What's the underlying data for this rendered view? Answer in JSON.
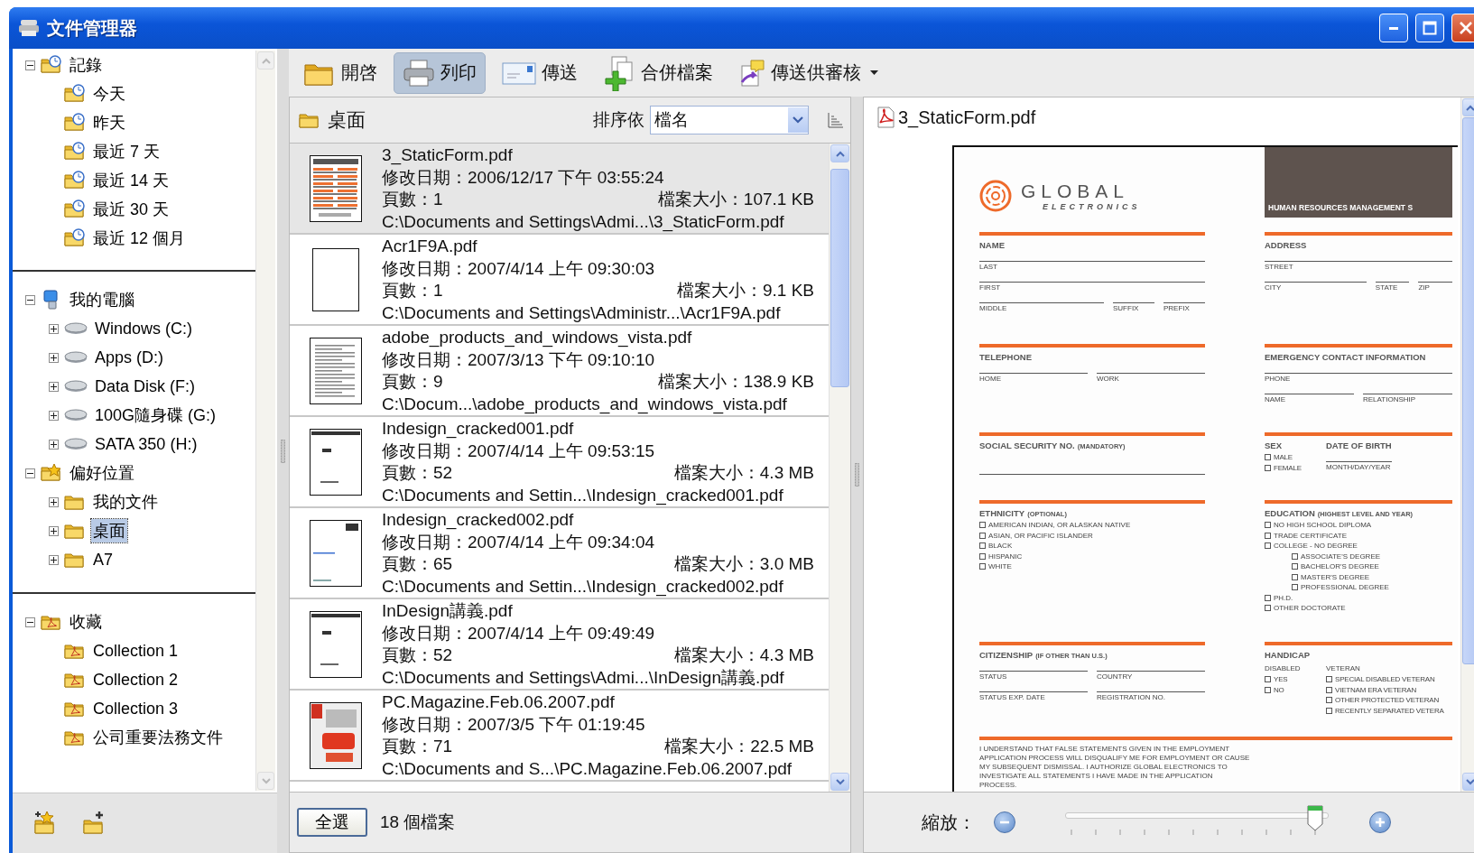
{
  "window": {
    "title": "文件管理器"
  },
  "sidebar": {
    "sections": [
      {
        "items": [
          {
            "label": "記錄",
            "kind": "history",
            "expanded": true,
            "selected": false,
            "children": [
              {
                "label": "今天",
                "kind": "clock",
                "selected": false
              },
              {
                "label": "昨天",
                "kind": "clock",
                "selected": false
              },
              {
                "label": "最近 7 天",
                "kind": "clock",
                "selected": false
              },
              {
                "label": "最近 14 天",
                "kind": "clock",
                "selected": false
              },
              {
                "label": "最近 30 天",
                "kind": "clock",
                "selected": false
              },
              {
                "label": "最近 12 個月",
                "kind": "clock",
                "selected": false
              }
            ]
          }
        ]
      },
      {
        "items": [
          {
            "label": "我的電腦",
            "kind": "computer",
            "expanded": true,
            "selected": false,
            "children": [
              {
                "label": "Windows (C:)",
                "kind": "drive",
                "expanded": false,
                "selected": false
              },
              {
                "label": "Apps (D:)",
                "kind": "drive",
                "expanded": false,
                "selected": false
              },
              {
                "label": "Data Disk (F:)",
                "kind": "drive",
                "expanded": false,
                "selected": false
              },
              {
                "label": "100G隨身碟 (G:)",
                "kind": "drive",
                "expanded": false,
                "selected": false
              },
              {
                "label": "SATA 350 (H:)",
                "kind": "drive",
                "expanded": false,
                "selected": false
              }
            ]
          },
          {
            "label": "偏好位置",
            "kind": "favorites",
            "expanded": true,
            "selected": false,
            "children": [
              {
                "label": "我的文件",
                "kind": "folder",
                "expanded": false,
                "selected": false
              },
              {
                "label": "桌面",
                "kind": "folder",
                "expanded": false,
                "selected": true
              },
              {
                "label": "A7",
                "kind": "folder",
                "expanded": false,
                "selected": false
              }
            ]
          }
        ]
      },
      {
        "items": [
          {
            "label": "收藏",
            "kind": "collection",
            "expanded": true,
            "selected": false,
            "children": [
              {
                "label": "Collection 1",
                "kind": "collection",
                "selected": false
              },
              {
                "label": "Collection 2",
                "kind": "collection",
                "selected": false
              },
              {
                "label": "Collection 3",
                "kind": "collection",
                "selected": false
              },
              {
                "label": "公司重要法務文件",
                "kind": "collection",
                "selected": false
              }
            ]
          }
        ]
      }
    ]
  },
  "toolbar": {
    "items": [
      {
        "label": "開啓",
        "kind": "open",
        "active": false,
        "menu": false
      },
      {
        "label": "列印",
        "kind": "print",
        "active": true,
        "menu": false
      },
      {
        "label": "傳送",
        "kind": "send",
        "active": false,
        "menu": false
      },
      {
        "label": "合併檔案",
        "kind": "merge",
        "active": false,
        "menu": false
      },
      {
        "label": "傳送供審核",
        "kind": "review",
        "active": false,
        "menu": true
      }
    ]
  },
  "file_list": {
    "location": "桌面",
    "sort_label": "排序依",
    "sort_value": "檔名",
    "files": [
      {
        "name": "3_StaticForm.pdf",
        "modified": "修改日期：2006/12/17 下午 03:55:24",
        "pages": "頁數：1",
        "size": "檔案大小：107.1 KB",
        "path": "C:\\Documents and Settings\\Admi...\\3_StaticForm.pdf",
        "kind": "form",
        "selected": true
      },
      {
        "name": "Acr1F9A.pdf",
        "modified": "修改日期：2007/4/14 上午 09:30:03",
        "pages": "頁數：1",
        "size": "檔案大小：9.1 KB",
        "path": "C:\\Documents and Settings\\Administr...\\Acr1F9A.pdf",
        "kind": "blank",
        "selected": false
      },
      {
        "name": "adobe_products_and_windows_vista.pdf",
        "modified": "修改日期：2007/3/13 下午 09:10:10",
        "pages": "頁數：9",
        "size": "檔案大小：138.9 KB",
        "path": "C:\\Docum...\\adobe_products_and_windows_vista.pdf",
        "kind": "text",
        "selected": false
      },
      {
        "name": "Indesign_cracked001.pdf",
        "modified": "修改日期：2007/4/14 上午 09:53:15",
        "pages": "頁數：52",
        "size": "檔案大小：4.3 MB",
        "path": "C:\\Documents and Settin...\\Indesign_cracked001.pdf",
        "kind": "layout",
        "selected": false
      },
      {
        "name": "Indesign_cracked002.pdf",
        "modified": "修改日期：2007/4/14 上午 09:34:04",
        "pages": "頁數：65",
        "size": "檔案大小：3.0 MB",
        "path": "C:\\Documents and Settin...\\Indesign_cracked002.pdf",
        "kind": "sparse",
        "selected": false
      },
      {
        "name": "InDesign講義.pdf",
        "modified": "修改日期：2007/4/14 上午 09:49:49",
        "pages": "頁數：52",
        "size": "檔案大小：4.3 MB",
        "path": "C:\\Documents and Settings\\Admi...\\InDesign講義.pdf",
        "kind": "layout",
        "selected": false
      },
      {
        "name": "PC.Magazine.Feb.06.2007.pdf",
        "modified": "修改日期：2007/3/5 下午 01:19:45",
        "pages": "頁數：71",
        "size": "檔案大小：22.5 MB",
        "path": "C:\\Documents and S...\\PC.Magazine.Feb.06.2007.pdf",
        "kind": "magazine",
        "selected": false
      }
    ],
    "select_all": "全選",
    "count": "18 個檔案"
  },
  "preview": {
    "title": "3_StaticForm.pdf",
    "zoom_label": "縮放：",
    "zoom": {
      "level": 0.95
    },
    "document": {
      "logo_title": "GLOBAL",
      "logo_subtitle": "ELECTRONICS",
      "banner": "HUMAN RESOURCES MANAGEMENT S",
      "rows": [
        {
          "left": {
            "title": "NAME",
            "kind": "fields",
            "rows": [
              [
                "LAST"
              ],
              [
                "FIRST"
              ],
              [
                "MIDDLE",
                "SUFFIX",
                "PREFIX"
              ]
            ]
          },
          "right": {
            "title": "ADDRESS",
            "kind": "fields",
            "rows": [
              [
                "STREET"
              ],
              [
                "CITY",
                "STATE",
                "ZIP"
              ]
            ]
          }
        },
        {
          "left": {
            "title": "TELEPHONE",
            "kind": "fields",
            "rows": [
              [
                "HOME",
                "WORK"
              ]
            ]
          },
          "right": {
            "title": "EMERGENCY CONTACT INFORMATION",
            "kind": "fields",
            "rows": [
              [
                "PHONE"
              ],
              [
                "NAME",
                "RELATIONSHIP"
              ]
            ]
          }
        },
        {
          "left": {
            "title": "SOCIAL SECURITY NO.",
            "note": "(MANDATORY)",
            "kind": "line"
          },
          "right": {
            "kind": "pair",
            "parts": [
              {
                "title": "SEX",
                "kind": "checks",
                "checks": [
                  {
                    "label": "MALE",
                    "checked": false
                  },
                  {
                    "label": "FEMALE",
                    "checked": false
                  }
                ]
              },
              {
                "title": "DATE OF BIRTH",
                "kind": "fields",
                "rows": [
                  [
                    "MONTH/DAY/YEAR"
                  ]
                ]
              }
            ]
          }
        },
        {
          "left": {
            "title": "ETHNICITY",
            "note": "(OPTIONAL)",
            "kind": "checks",
            "checks": [
              {
                "label": "AMERICAN INDIAN, OR ALASKAN NATIVE",
                "checked": false
              },
              {
                "label": "ASIAN, OR PACIFIC ISLANDER",
                "checked": false
              },
              {
                "label": "BLACK",
                "checked": false
              },
              {
                "label": "HISPANIC",
                "checked": false
              },
              {
                "label": "WHITE",
                "checked": false
              }
            ]
          },
          "right": {
            "title": "EDUCATION",
            "note": "(HIGHEST LEVEL AND YEAR)",
            "kind": "checks",
            "checks": [
              {
                "label": "NO HIGH SCHOOL DIPLOMA",
                "checked": false
              },
              {
                "label": "TRADE CERTIFICATE",
                "checked": false
              },
              {
                "label": "COLLEGE - NO DEGREE",
                "checked": false,
                "children": [
                  {
                    "label": "ASSOCIATE'S DEGREE",
                    "checked": false
                  },
                  {
                    "label": "BACHELOR'S DEGREE",
                    "checked": false
                  },
                  {
                    "label": "MASTER'S DEGREE",
                    "checked": false
                  },
                  {
                    "label": "PROFESSIONAL DEGREE",
                    "checked": false
                  }
                ]
              },
              {
                "label": "PH.D.",
                "checked": false
              },
              {
                "label": "OTHER DOCTORATE",
                "checked": false
              }
            ]
          }
        },
        {
          "left": {
            "title": "CITIZENSHIP",
            "note": "(IF OTHER THAN U.S.)",
            "kind": "fields",
            "rows": [
              [
                "STATUS",
                "COUNTRY"
              ],
              [
                "STATUS EXP. DATE",
                "REGISTRATION NO."
              ]
            ]
          },
          "right": {
            "title": "HANDICAP",
            "kind": "pair",
            "parts": [
              {
                "subtitle": "DISABLED",
                "kind": "checks",
                "checks": [
                  {
                    "label": "YES",
                    "checked": false
                  },
                  {
                    "label": "NO",
                    "checked": false
                  }
                ]
              },
              {
                "subtitle": "VETERAN",
                "kind": "checks",
                "checks": [
                  {
                    "label": "SPECIAL DISABLED VETERAN",
                    "checked": false
                  },
                  {
                    "label": "VIETNAM ERA VETERAN",
                    "checked": false
                  },
                  {
                    "label": "OTHER PROTECTED VETERAN",
                    "checked": false
                  },
                  {
                    "label": "RECENTLY SEPARATED VETERA",
                    "checked": false
                  }
                ]
              }
            ]
          }
        }
      ],
      "statement": "I UNDERSTAND THAT FALSE STATEMENTS GIVEN IN THE EMPLOYMENT APPLICATION PROCESS WILL DISQUALIFY ME FOR EMPLOYMENT OR CAUSE MY SUBSEQUENT DISMISSAL. I AUTHORIZE GLOBAL ELECTRONICS TO INVESTIGATE ALL STATEMENTS I HAVE MADE IN THE APPLICATION PROCESS."
    }
  }
}
